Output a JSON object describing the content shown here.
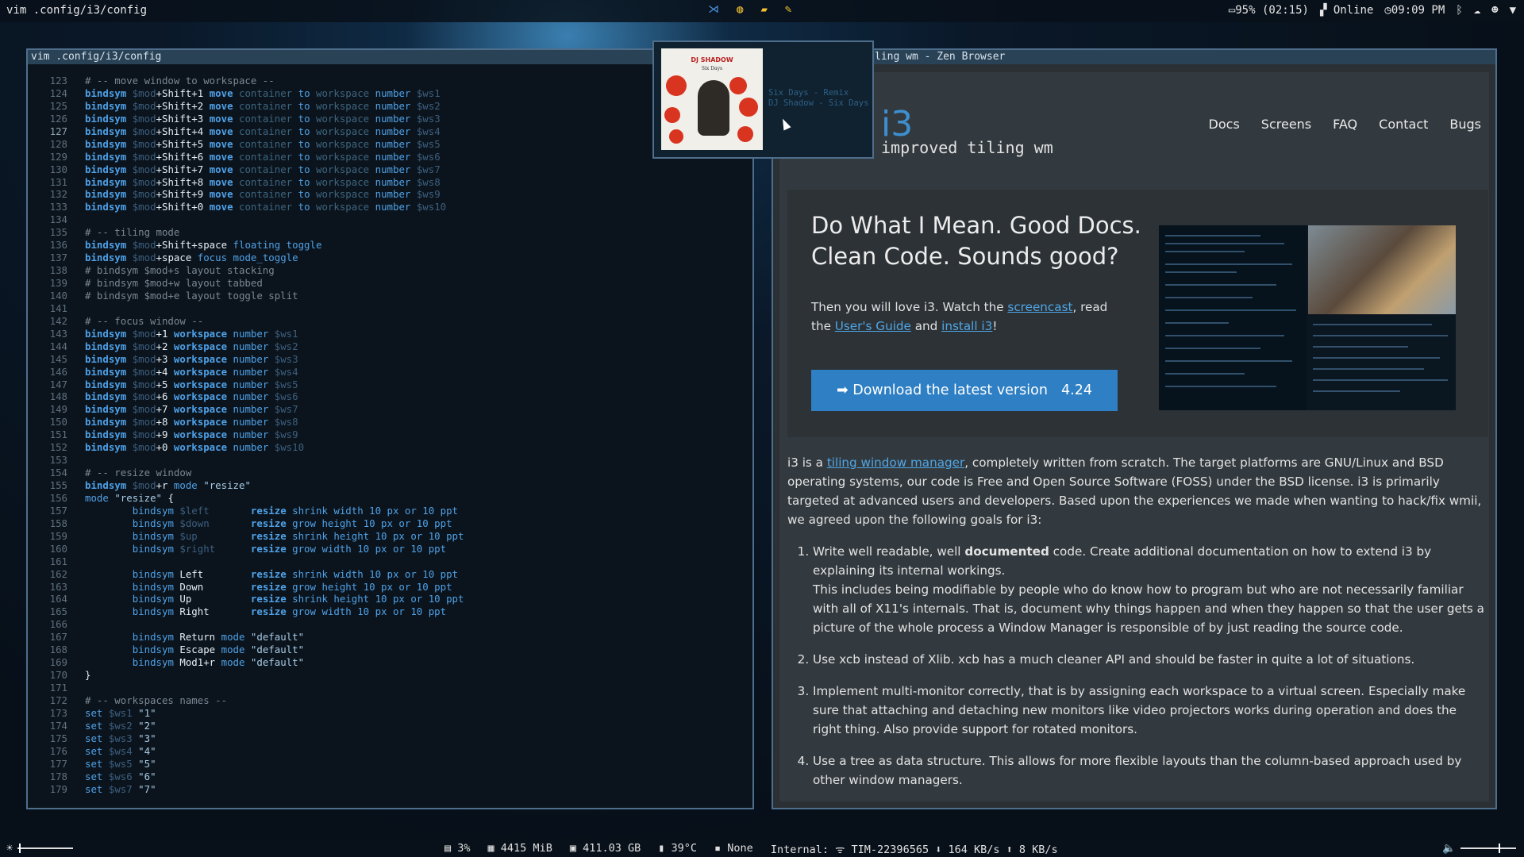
{
  "topbar": {
    "window_title": "vim .config/i3/config",
    "center_icons": [
      "vscode-icon",
      "globe-icon",
      "folder-icon",
      "notes-icon"
    ],
    "battery": "95% (02:15)",
    "network": "Online",
    "clock": "09:09 PM",
    "tray_icons": [
      "bluetooth-icon",
      "cloud-icon",
      "discord-icon",
      "wifi-icon"
    ]
  },
  "vim": {
    "title": "vim .config/i3/config"
  },
  "browser": {
    "title": "ling wm - Zen Browser",
    "logo": "i3",
    "tagline": "improved tiling wm",
    "nav": [
      "Docs",
      "Screens",
      "FAQ",
      "Contact",
      "Bugs"
    ],
    "hero_title": "Do What I Mean. Good Docs. Clean Code. Sounds good?",
    "hero_text_1": "Then you will love i3. Watch the ",
    "hero_link_1": "screencast",
    "hero_text_2": ", read the ",
    "hero_link_2": "User's Guide",
    "hero_text_3": " and ",
    "hero_link_3": "install i3",
    "hero_text_4": "!",
    "download_label": "➡ Download the latest version",
    "download_version": "4.24",
    "intro_1": "i3 is a ",
    "intro_link": "tiling window manager",
    "intro_2": ", completely written from scratch. The target platforms are GNU/Linux and BSD operating systems, our code is Free and Open Source Software (FOSS) under the BSD license. i3 is primarily targeted at advanced users and developers. Based upon the experiences we made when wanting to hack/fix wmii, we agreed upon the following goals for i3:",
    "goal1_a": "Write well readable, well ",
    "goal1_b": "documented",
    "goal1_c": " code. Create additional documentation on how to extend i3 by explaining its internal workings.",
    "goal1_d": "This includes being modifiable by people who do know how to program but who are not necessarily familiar with all of X11's internals. That is, document why things happen and when they happen so that the user gets a picture of the whole process a Window Manager is responsible of by just reading the source code.",
    "goal2": "Use xcb instead of Xlib. xcb has a much cleaner API and should be faster in quite a lot of situations.",
    "goal3": "Implement multi-monitor correctly, that is by assigning each workspace to a virtual screen. Especially make sure that attaching and detaching new monitors like video projectors works during operation and does the right thing. Also provide support for rotated monitors.",
    "goal4": "Use a tree as data structure. This allows for more flexible layouts than the column-based approach used by other window managers."
  },
  "popup": {
    "cover_artist": "DJ SHADOW",
    "cover_title": "Six Days",
    "track": "Six Days - Remix",
    "artist_track": "DJ Shadow - Six Days"
  },
  "bottombar": {
    "cpu": "3%",
    "mem": "4415 MiB",
    "disk": "411.03 GB",
    "temp": "39°C",
    "kbd": "None",
    "net": "Internal: ᯤ TIM-22396565 ⬇ 164 KB/s ⬆ 8 KB/s",
    "brightness_fraction": 0.05,
    "volume_fraction": 0.7
  }
}
